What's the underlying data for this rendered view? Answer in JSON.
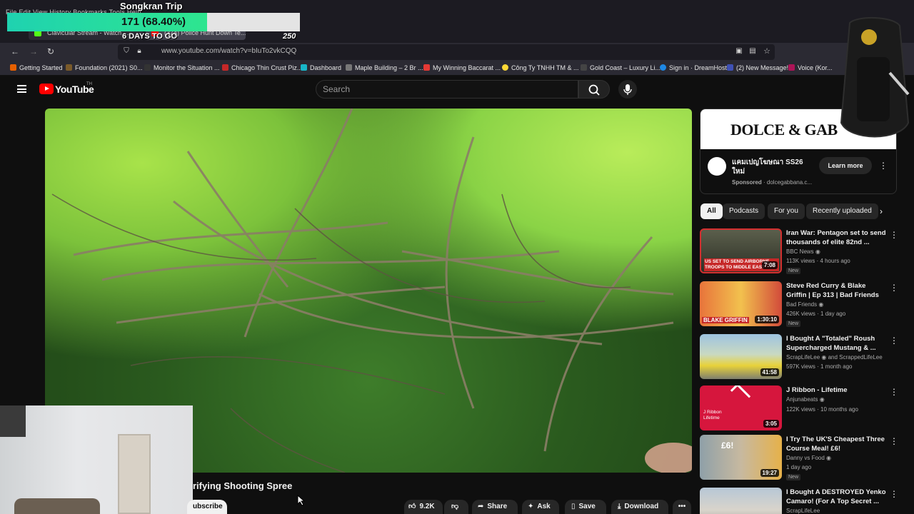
{
  "overlay": {
    "title": "Songkran Trip",
    "progress_text": "171 (68.40%)",
    "progress_fraction": 0.684,
    "days_left": "6 DAYS TO GO",
    "goal": "250"
  },
  "browser": {
    "menubar": "File  Edit  View  History  Bookmarks  Tools  Help",
    "tabs": [
      {
        "label": "Clavicular Stream - Watch ..."
      },
      {
        "label": "(374) Police Hunt Down Te..."
      }
    ],
    "url": "www.youtube.com/watch?v=bIuTo2vkCQQ",
    "bookmarks": [
      {
        "label": "Getting Started"
      },
      {
        "label": "Foundation (2021) S0..."
      },
      {
        "label": "Monitor the Situation ..."
      },
      {
        "label": "Chicago Thin Crust Piz..."
      },
      {
        "label": "Dashboard"
      },
      {
        "label": "Maple Building – 2 Br ..."
      },
      {
        "label": "My Winning Baccarat ..."
      },
      {
        "label": "Công Ty TNHH TM & ..."
      },
      {
        "label": "Gold Coast – Luxury Li..."
      },
      {
        "label": "Sign in · DreamHost"
      },
      {
        "label": "(2) New Message!"
      },
      {
        "label": "Voice (Kor..."
      }
    ]
  },
  "youtube": {
    "logo_text": "YouTube",
    "logo_sup": "TH",
    "search_placeholder": "Search",
    "video_title": "rifying Shooting Spree",
    "subscribe_label": "ubscribe",
    "actions": {
      "likes": "9.2K",
      "share": "Share",
      "ask": "Ask",
      "save": "Save",
      "download": "Download"
    }
  },
  "ad": {
    "brand": "DOLCE & GAB",
    "title": "แคมเปญโฆษณา SS26 ใหม่",
    "sponsored": "Sponsored",
    "domain": "· dolcegabbana.c...",
    "cta": "Learn more"
  },
  "chips": [
    "All",
    "Podcasts",
    "For you",
    "Recently uploaded"
  ],
  "recommendations": [
    {
      "title": "Iran War:  Pentagon set to send thousands of elite 82nd ...",
      "channel": "BBC News",
      "meta": "113K views · 4 hours ago",
      "badge": "New",
      "duration": "7:08",
      "thumb_caption": "US SET TO SEND AIRBORNE TROOPS TO MIDDLE EAST"
    },
    {
      "title": "Steve Red Curry & Blake Griffin | Ep 313 | Bad Friends",
      "channel": "Bad Friends",
      "meta": "426K views · 1 day ago",
      "badge": "New",
      "duration": "1:30:10",
      "thumb_caption": "BLAKE GRIFFIN"
    },
    {
      "title": "I Bought A \"Totaled\" Roush Supercharged Mustang & ...",
      "channel": "ScrapLifeLee",
      "channel_extra": "and ScrappedLifeLee",
      "meta": "597K views · 1 month ago",
      "badge": "",
      "duration": "41:58",
      "thumb_caption": ""
    },
    {
      "title": "J Ribbon - Lifetime",
      "channel": "Anjunabeats",
      "meta": "122K views · 10 months ago",
      "badge": "",
      "duration": "3:05",
      "thumb_caption": "J Ribbon Lifetime"
    },
    {
      "title": "I Try The UK'S Cheapest Three Course Meal! £6!",
      "channel": "Danny vs Food",
      "meta": "1 day ago",
      "badge": "New",
      "duration": "19:27",
      "thumb_caption": "£6!"
    },
    {
      "title": "I Bought A DESTROYED Yenko Camaro! (For A Top Secret ...",
      "channel": "ScrapLifeLee",
      "meta": "",
      "badge": "",
      "duration": "",
      "thumb_caption": ""
    }
  ],
  "colors": {
    "youtube_red": "#ff0000",
    "progress_fill": "#2ee58f",
    "background": "#0f0f0f"
  }
}
